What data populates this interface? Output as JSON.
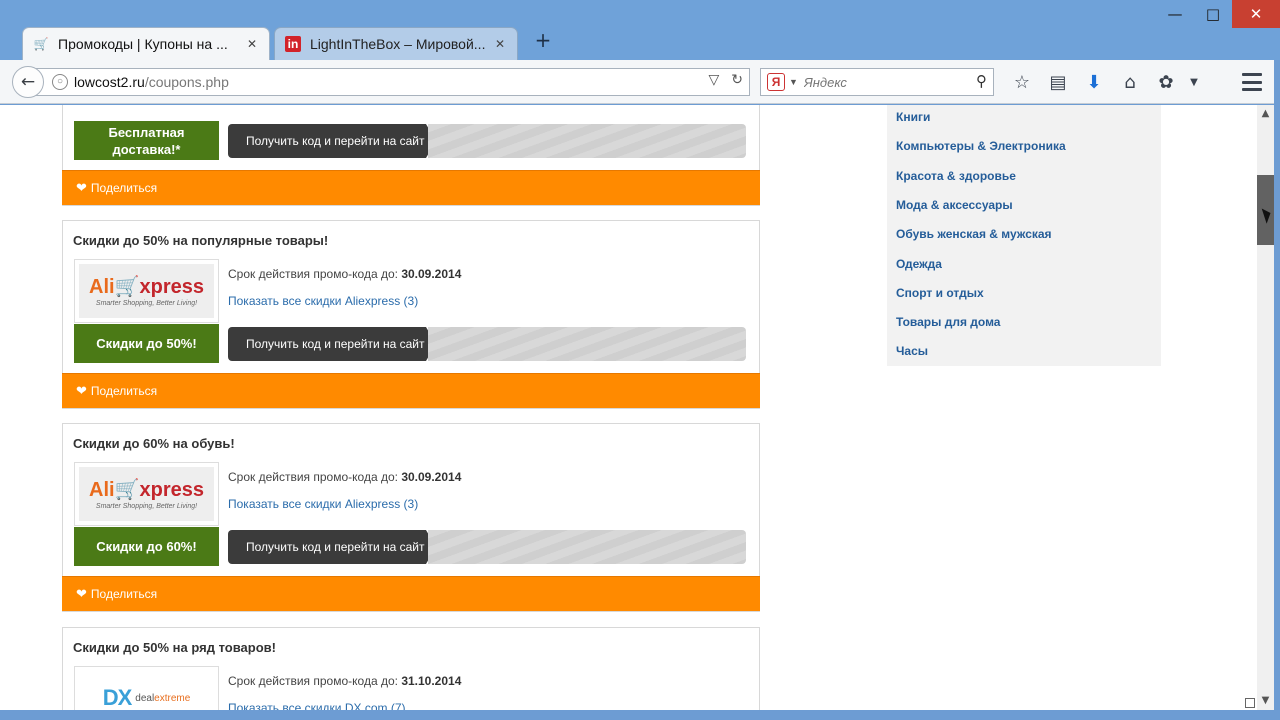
{
  "browser": {
    "tabs": [
      {
        "title": "Промокоды | Купоны на ...",
        "active": true
      },
      {
        "title": "LightInTheBox – Мировой...",
        "active": false
      }
    ],
    "url_host": "lowcost2.ru",
    "url_path": "/coupons.php",
    "search_placeholder": "Яндекс"
  },
  "coupons": [
    {
      "title": "",
      "deal": "Бесплатная доставка!*",
      "button": "Получить код и перейти на сайт",
      "share": "Поделиться"
    },
    {
      "title": "Скидки до 50% на популярные товары!",
      "logo_brand": "AliExpress",
      "logo_ali": "Ali",
      "logo_xp": "xpress",
      "logo_sub": "Smarter Shopping, Better Living!",
      "validity_label": "Срок действия промо-кода до:",
      "validity_date": "30.09.2014",
      "show_all": "Показать все скидки Aliexpress (3)",
      "deal": "Скидки до 50%!",
      "button": "Получить код и перейти на сайт",
      "share": "Поделиться"
    },
    {
      "title": "Скидки до 60% на обувь!",
      "logo_ali": "Ali",
      "logo_xp": "xpress",
      "logo_sub": "Smarter Shopping, Better Living!",
      "validity_label": "Срок действия промо-кода до:",
      "validity_date": "30.09.2014",
      "show_all": "Показать все скидки Aliexpress (3)",
      "deal": "Скидки до 60%!",
      "button": "Получить код и перейти на сайт",
      "share": "Поделиться"
    },
    {
      "title": "Скидки до 50% на ряд товаров!",
      "logo_dx": "DX",
      "logo_deal": "deal",
      "logo_extreme": "extreme",
      "validity_label": "Срок действия промо-кода до:",
      "validity_date": "31.10.2014",
      "show_all": "Показать все скидки DX.com (7)"
    }
  ],
  "categories": [
    "Книги",
    "Компьютеры & Электроника",
    "Красота & здоровье",
    "Мода & аксессуары",
    "Обувь женская & мужская",
    "Одежда",
    "Спорт и отдых",
    "Товары для дома",
    "Часы"
  ],
  "colors": {
    "share_bar": "#ff8a00",
    "deal_badge": "#4b7a16",
    "link": "#2b6cab",
    "category_link": "#255d99"
  }
}
